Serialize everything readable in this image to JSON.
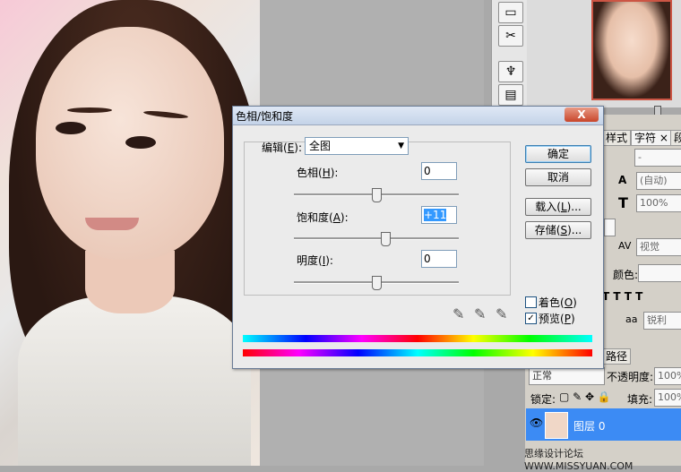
{
  "dialog": {
    "title": "色相/饱和度",
    "close_glyph": "X",
    "edit": {
      "label": "编辑(",
      "mnemonic": "E",
      "suffix": "):",
      "value": "全图"
    },
    "hue": {
      "label": "色相(",
      "mnemonic": "H",
      "suffix": "):",
      "value": "0",
      "level": 0.5
    },
    "saturation": {
      "label": "饱和度(",
      "mnemonic": "A",
      "suffix": "):",
      "value": "+11",
      "level": 0.555
    },
    "lightness": {
      "label": "明度(",
      "mnemonic": "I",
      "suffix": "):",
      "value": "0",
      "level": 0.5
    },
    "buttons": {
      "ok": "确定",
      "cancel": "取消",
      "load": {
        "label": "载入(",
        "mnemonic": "L",
        "suffix": ")..."
      },
      "save": {
        "label": "存储(",
        "mnemonic": "S",
        "suffix": ")..."
      }
    },
    "colorize": {
      "label": "着色(",
      "mnemonic": "O",
      "suffix": ")",
      "checked": false
    },
    "preview": {
      "label": "预览(",
      "mnemonic": "P",
      "suffix": ")",
      "checked": true,
      "check_glyph": "✓"
    }
  },
  "panels": {
    "tabs": [
      "样式",
      "字符",
      "段"
    ],
    "tab_close_glyph": "×",
    "character": {
      "font_size_placeholder": "-",
      "leading": "(自动)",
      "scale": "100%",
      "kerning": "视觉",
      "color_label": "颜色:",
      "styles": "T T T T",
      "antialias_label": "aa",
      "antialias": "锐利"
    },
    "layers": {
      "tab": "路径",
      "blend_mode": "正常",
      "opacity_label": "不透明度:",
      "opacity": "100%",
      "lock_label": "锁定:",
      "fill_label": "填充:",
      "fill": "100%",
      "layer_name": "图层 0"
    },
    "watermark": "思缘设计论坛  WWW.MISSYUAN.COM"
  }
}
